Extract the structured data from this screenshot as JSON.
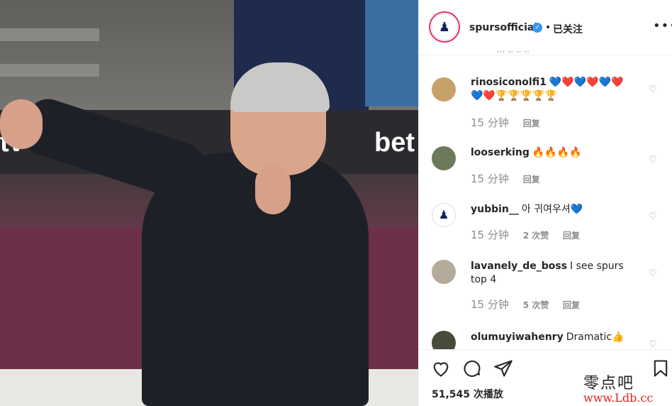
{
  "post": {
    "username": "spursofficial",
    "follow_status": "已关注",
    "separator": "•",
    "more_icon": "more-horizontal-icon",
    "cutoff_text": "··· ·· ·· ··"
  },
  "media": {
    "board_text_left": "tv",
    "board_text_right": "bet"
  },
  "comments": [
    {
      "user": "rinosiconolfi1",
      "text": "💙❤️💙❤️💙❤️💙❤️🏆🏆🏆🏆🏆",
      "time": "15 分钟",
      "replies": "",
      "reply_label": "回复"
    },
    {
      "user": "looserking",
      "text": "🔥🔥🔥🔥",
      "time": "15 分钟",
      "replies": "",
      "reply_label": "回复"
    },
    {
      "user": "yubbin__",
      "text": "아 귀여우셔💙",
      "time": "15 分钟",
      "replies": "2 次赞",
      "reply_label": "回复"
    },
    {
      "user": "lavanely_de_boss",
      "text": "I see spurs top 4",
      "time": "15 分钟",
      "replies": "5 次赞",
      "reply_label": "回复"
    },
    {
      "user": "olumuyiwahenry",
      "text": "Dramatic👍",
      "time": "",
      "replies": "",
      "reply_label": ""
    }
  ],
  "actions": {
    "plays": "51,545 次播放"
  },
  "watermark": {
    "line1": "零点吧",
    "line2": "www.Ldb.cc"
  },
  "colors": {
    "verified": "#3897f0",
    "ring": "#e1306c",
    "meta": "#8e8e8e"
  }
}
